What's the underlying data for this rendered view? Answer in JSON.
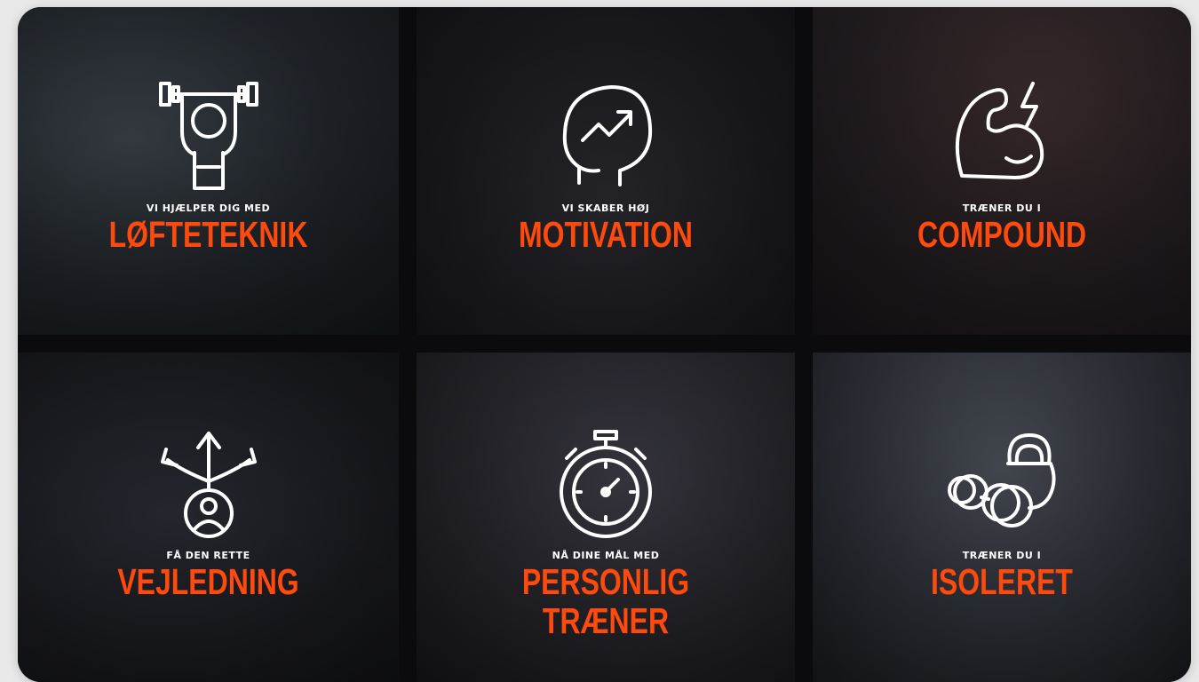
{
  "tiles": [
    {
      "kicker": "VI HJÆLPER DIG MED",
      "title": "LØFTETEKNIK",
      "icon": "weightlifter-icon"
    },
    {
      "kicker": "VI SKABER HØJ",
      "title": "MOTIVATION",
      "icon": "head-growth-icon"
    },
    {
      "kicker": "TRÆNER DU I",
      "title": "COMPOUND",
      "icon": "flexed-arm-icon"
    },
    {
      "kicker": "FÅ DEN RETTE",
      "title": "VEJLEDNING",
      "icon": "direction-person-icon"
    },
    {
      "kicker": "NÅ DINE MÅL MED",
      "title": "PERSONLIG TRÆNER",
      "icon": "stopwatch-icon"
    },
    {
      "kicker": "TRÆNER DU I",
      "title": "ISOLERET",
      "icon": "kettlebell-dumbbell-icon"
    }
  ],
  "colors": {
    "accent": "#ff4a0d",
    "text": "#ffffff",
    "gutter": "#0b0b0d"
  }
}
